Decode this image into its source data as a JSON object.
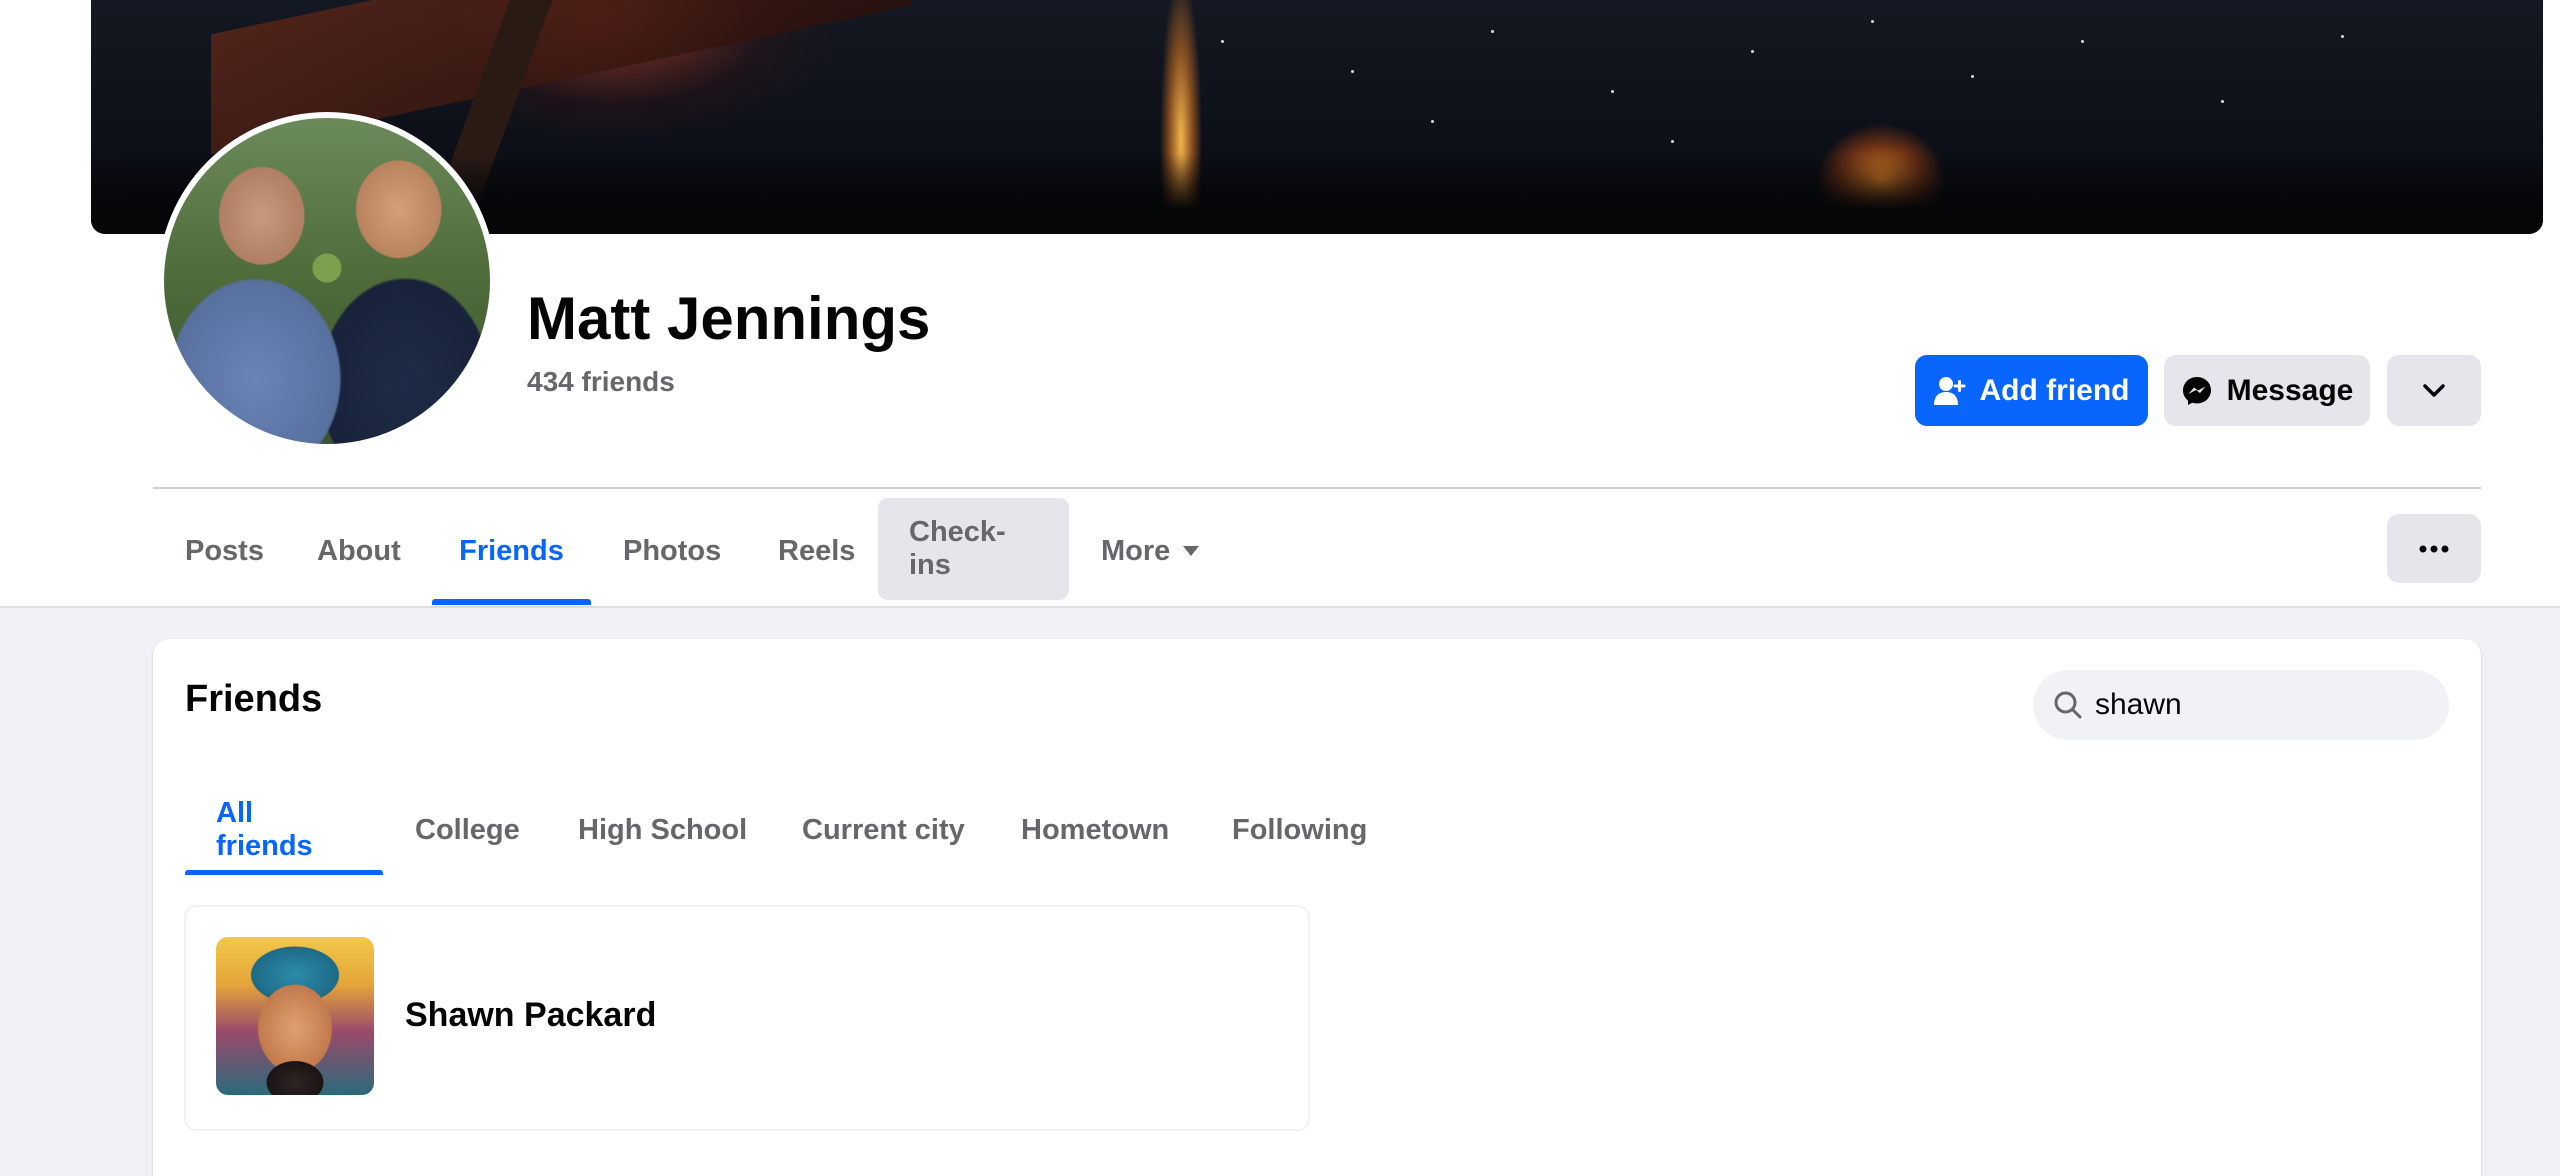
{
  "profile": {
    "name": "Matt Jennings",
    "friend_count": "434 friends"
  },
  "actions": {
    "add_friend": "Add friend",
    "message": "Message"
  },
  "profile_tabs": [
    {
      "label": "Posts"
    },
    {
      "label": "About"
    },
    {
      "label": "Friends"
    },
    {
      "label": "Photos"
    },
    {
      "label": "Reels"
    },
    {
      "label": "Check-ins"
    },
    {
      "label": "More"
    }
  ],
  "friends_section": {
    "title": "Friends",
    "search_value": "shawn",
    "tabs": [
      {
        "label": "All friends"
      },
      {
        "label": "College"
      },
      {
        "label": "High School"
      },
      {
        "label": "Current city"
      },
      {
        "label": "Hometown"
      },
      {
        "label": "Following"
      }
    ],
    "results": [
      {
        "name": "Shawn Packard"
      }
    ]
  },
  "colors": {
    "accent": "#0866ff",
    "secondary_text": "#65676b",
    "button_gray": "#e4e6eb",
    "page_bg": "#f0f2f5"
  },
  "icons": {
    "add_friend": "person-plus-icon",
    "message": "messenger-icon",
    "more_dropdown": "chevron-down-icon",
    "overflow": "ellipsis-icon",
    "search": "search-icon"
  }
}
